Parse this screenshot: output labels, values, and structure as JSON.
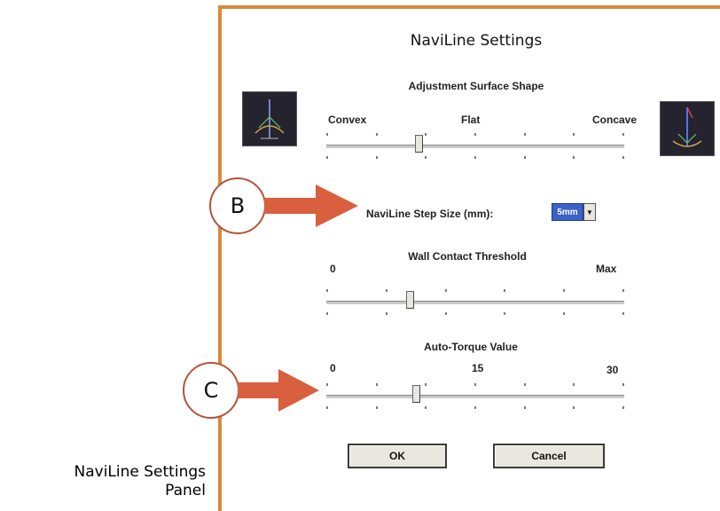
{
  "caption": {
    "line1": "NaviLine Settings",
    "line2": "Panel"
  },
  "panel": {
    "title": "NaviLine Settings",
    "surface": {
      "section_title": "Adjustment Surface Shape",
      "left_label": "Convex",
      "mid_label": "Flat",
      "right_label": "Concave",
      "left_image_icon": "convex-surface-thumbnail",
      "right_image_icon": "concave-surface-thumbnail",
      "value_fraction": 0.31
    },
    "step_size": {
      "label": "NaviLine Step Size (mm):",
      "selected_value": "5mm"
    },
    "wall_contact": {
      "section_title": "Wall Contact Threshold",
      "min_label": "0",
      "max_label": "Max",
      "value_fraction": 0.28
    },
    "auto_torque": {
      "section_title": "Auto-Torque Value",
      "min_label": "0",
      "mid_label": "15",
      "max_label": "30",
      "value": 9
    },
    "ok_label": "OK",
    "cancel_label": "Cancel"
  },
  "callouts": {
    "b_label": "B",
    "c_label": "C",
    "color": "#d9603e"
  }
}
